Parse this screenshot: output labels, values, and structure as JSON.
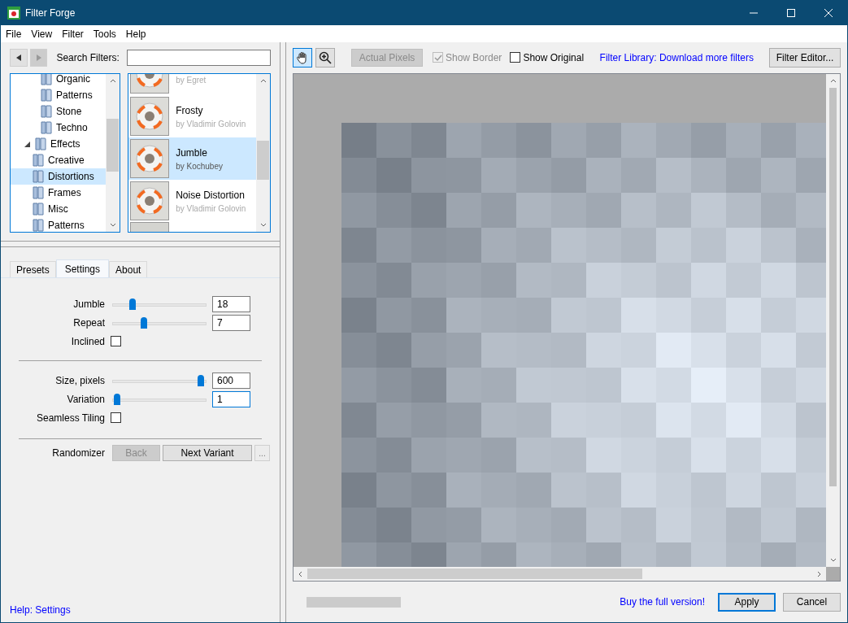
{
  "window": {
    "title": "Filter Forge"
  },
  "menu": [
    "File",
    "View",
    "Filter",
    "Tools",
    "Help"
  ],
  "search": {
    "label": "Search Filters:"
  },
  "tree": [
    {
      "label": "Organic",
      "selected": false
    },
    {
      "label": "Patterns",
      "selected": false
    },
    {
      "label": "Stone",
      "selected": false
    },
    {
      "label": "Techno",
      "selected": false
    },
    {
      "label": "Effects",
      "selected": false,
      "expanded": true,
      "children": [
        {
          "label": "Creative",
          "selected": false
        },
        {
          "label": "Distortions",
          "selected": true
        },
        {
          "label": "Frames",
          "selected": false
        },
        {
          "label": "Misc",
          "selected": false
        },
        {
          "label": "Patterns",
          "selected": false
        }
      ]
    }
  ],
  "filters": [
    {
      "author": "by Egret",
      "selected": false
    },
    {
      "name": "Frosty",
      "author": "by Vladimir Golovin",
      "selected": false
    },
    {
      "name": "Jumble",
      "author": "by Kochubey",
      "selected": true
    },
    {
      "name": "Noise Distortion",
      "author": "by Vladimir Golovin",
      "selected": false
    }
  ],
  "tabs": [
    {
      "label": "Presets",
      "selected": false
    },
    {
      "label": "Settings",
      "selected": true
    },
    {
      "label": "About",
      "selected": false
    }
  ],
  "settings": [
    [
      {
        "kind": "slider",
        "label": "Jumble",
        "level": 0.19,
        "value": "18",
        "focused": false
      },
      {
        "kind": "slider",
        "label": "Repeat",
        "level": 0.32,
        "value": "7",
        "focused": false
      },
      {
        "kind": "checkbox",
        "label": "Inclined",
        "checked": false
      }
    ],
    [
      {
        "kind": "slider",
        "label": "Size, pixels",
        "level": 0.97,
        "value": "600",
        "focused": false
      },
      {
        "kind": "slider",
        "label": "Variation",
        "level": 0.02,
        "value": "1",
        "focused": true
      },
      {
        "kind": "checkbox",
        "label": "Seamless Tiling",
        "checked": false
      }
    ]
  ],
  "randomizer": {
    "label": "Randomizer",
    "back": {
      "label": "Back",
      "disabled": true
    },
    "next": {
      "label": "Next Variant",
      "disabled": false
    },
    "more": "..."
  },
  "help_link": "Help: Settings",
  "toolbar": {
    "hand_selected": true,
    "actual_pixels": {
      "label": "Actual Pixels",
      "disabled": true
    },
    "show_border": {
      "label": "Show Border",
      "checked": true,
      "disabled": true
    },
    "show_original": {
      "label": "Show Original",
      "checked": false,
      "disabled": false
    },
    "library_link": "Filter Library: Download more filters",
    "editor_button": "Filter Editor..."
  },
  "progress": {
    "level": 0
  },
  "footer": {
    "buy_link": "Buy the full version!",
    "apply": "Apply",
    "cancel": "Cancel"
  }
}
